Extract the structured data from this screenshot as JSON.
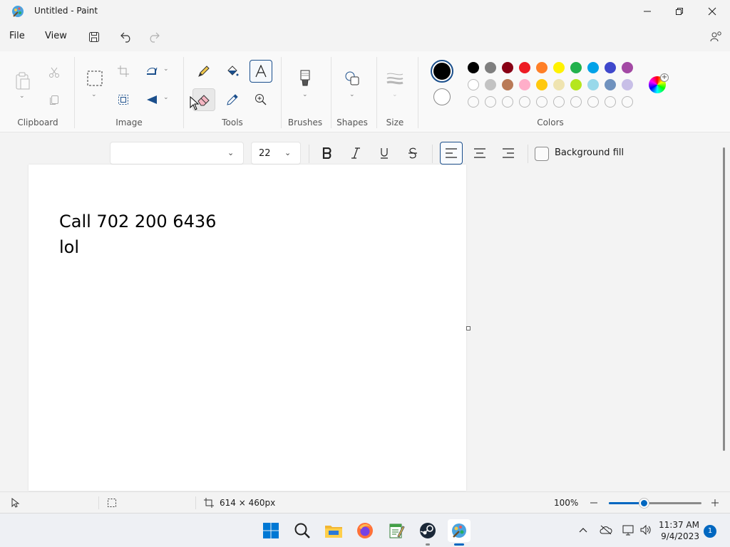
{
  "window": {
    "title": "Untitled - Paint"
  },
  "menu": {
    "file": "File",
    "view": "View"
  },
  "ribbon": {
    "groups": {
      "clipboard": "Clipboard",
      "image": "Image",
      "tools": "Tools",
      "brushes": "Brushes",
      "shapes": "Shapes",
      "size": "Size",
      "colors": "Colors"
    }
  },
  "palette": {
    "primary": "#000000",
    "secondary": "#ffffff",
    "row1": [
      "#000000",
      "#7f7f7f",
      "#880015",
      "#ed1c24",
      "#ff7f27",
      "#fff200",
      "#22b14c",
      "#00a2e8",
      "#3f48cc",
      "#a349a4"
    ],
    "row2": [
      "#ffffff",
      "#c3c3c3",
      "#b97a57",
      "#ffaec9",
      "#ffc90e",
      "#efe4b0",
      "#b5e61d",
      "#99d9ea",
      "#7092be",
      "#c8bfe7"
    ],
    "row3_custom_count": 10
  },
  "text_toolbar": {
    "font_value": "",
    "size_value": "22",
    "background_fill_label": "Background fill",
    "background_fill_checked": false
  },
  "canvas": {
    "text_line1": "Call 702 200 6436",
    "text_line2": "lol"
  },
  "status": {
    "canvas_size": "614 × 460px",
    "zoom": "100%",
    "zoom_fraction": 0.38
  },
  "taskbar": {
    "time": "11:37 AM",
    "date": "9/4/2023",
    "notifications": "1"
  }
}
